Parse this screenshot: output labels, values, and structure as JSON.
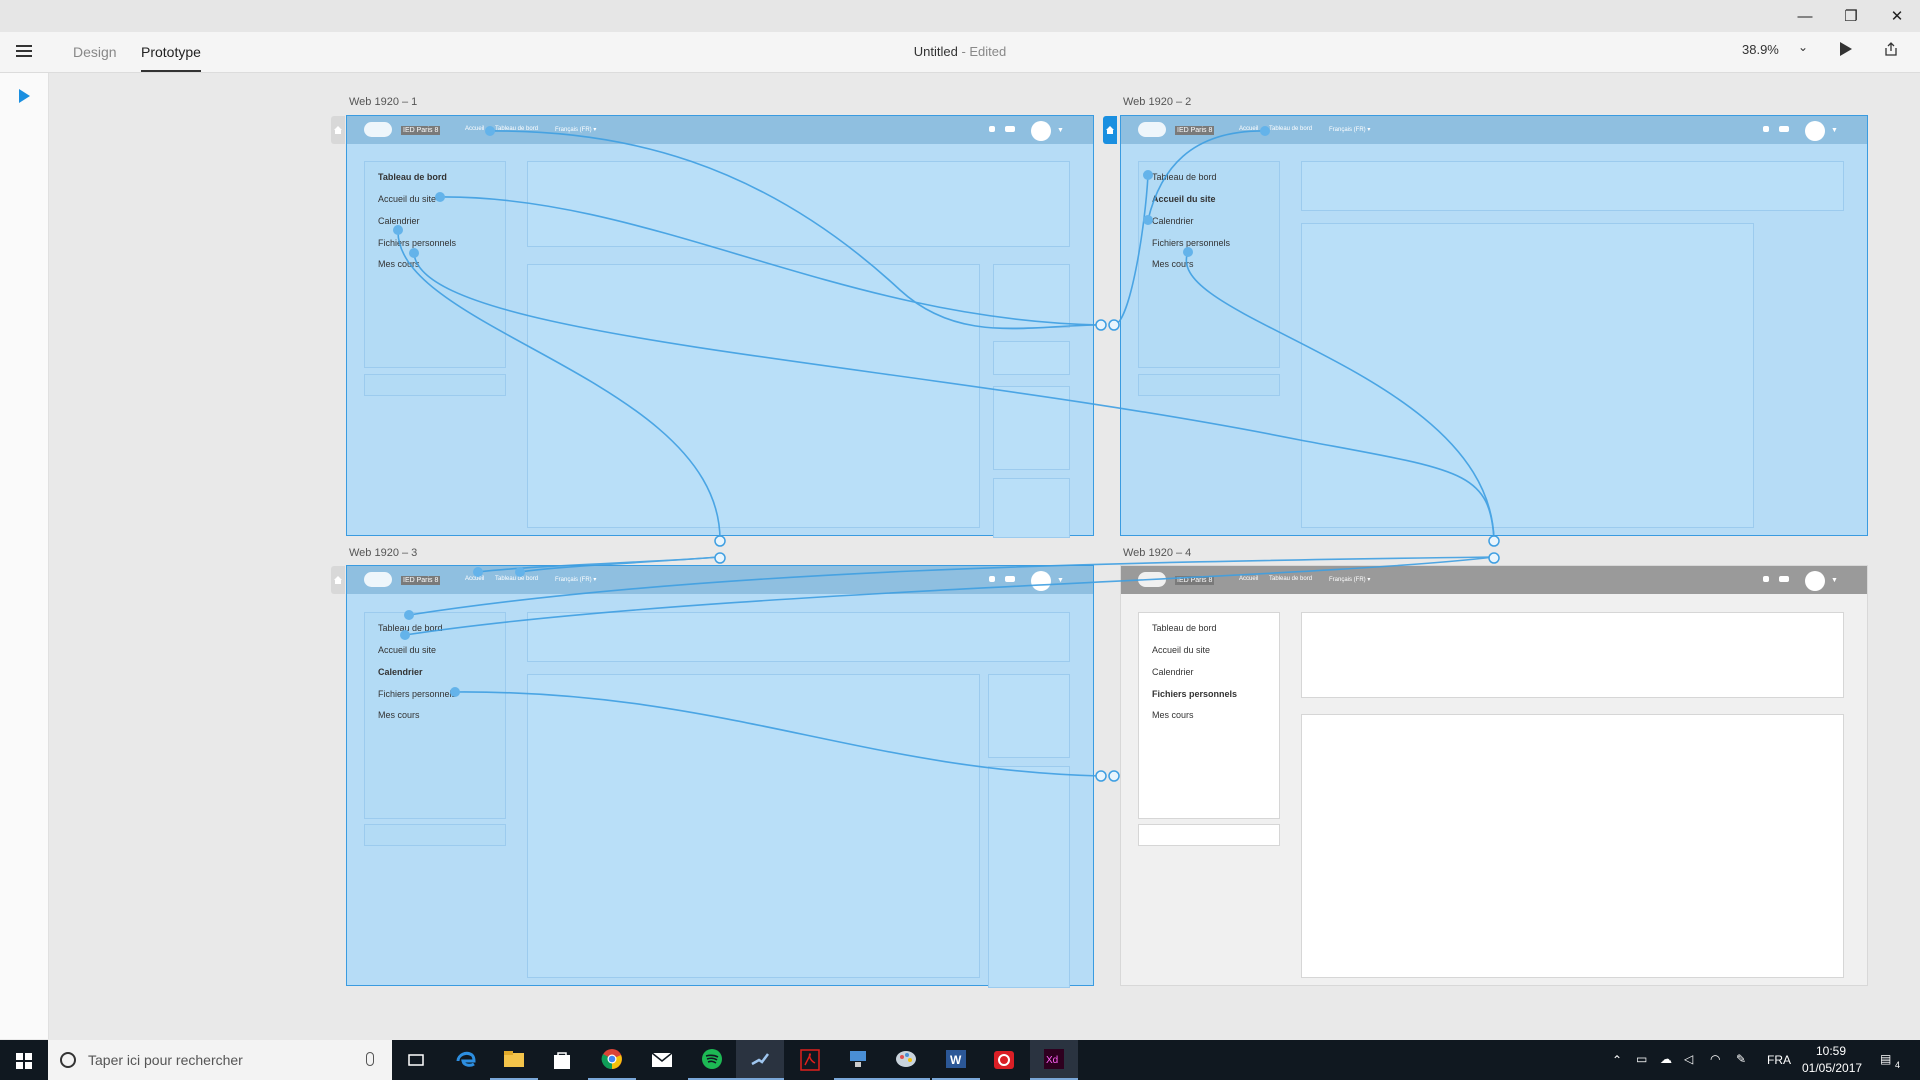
{
  "window": {
    "minimize_glyph": "—",
    "maximize_glyph": "❐",
    "close_glyph": "✕"
  },
  "toolbar": {
    "menu_icon": "hamburger-icon",
    "tabs": [
      {
        "label": "Design",
        "active": false
      },
      {
        "label": "Prototype",
        "active": true
      }
    ],
    "doc_title": "Untitled",
    "doc_status": " - Edited",
    "zoom": "38.9%",
    "zoom_caret": "⌄",
    "play_icon": "play-icon",
    "share_icon": "share-icon"
  },
  "tools": {
    "select_icon": "pointer-icon"
  },
  "artboards": [
    {
      "label": "Web 1920 – 1",
      "header": {
        "logo": "IED Paris 8",
        "nav": [
          "Accueil",
          "Tableau de bord",
          "Français (FR) ▾"
        ]
      },
      "menu": [
        "Tableau de bord",
        "Accueil du site",
        "Calendrier",
        "Fichiers personnels",
        "Mes cours"
      ],
      "active_item": 0
    },
    {
      "label": "Web 1920 – 2",
      "header": {
        "logo": "IED Paris 8",
        "nav": [
          "Accueil",
          "Tableau de bord",
          "Français (FR) ▾"
        ]
      },
      "menu": [
        "Tableau de bord",
        "Accueil du site",
        "Calendrier",
        "Fichiers personnels",
        "Mes cours"
      ],
      "active_item": 1
    },
    {
      "label": "Web 1920 – 3",
      "header": {
        "logo": "IED Paris 8",
        "nav": [
          "Accueil",
          "Tableau de bord",
          "Français (FR) ▾"
        ]
      },
      "menu": [
        "Tableau de bord",
        "Accueil du site",
        "Calendrier",
        "Fichiers personnels",
        "Mes cours"
      ],
      "active_item": 2
    },
    {
      "label": "Web 1920 – 4",
      "header": {
        "logo": "IED Paris 8",
        "nav": [
          "Accueil",
          "Tableau de bord",
          "Français (FR) ▾"
        ]
      },
      "menu": [
        "Tableau de bord",
        "Accueil du site",
        "Calendrier",
        "Fichiers personnels",
        "Mes cours"
      ],
      "active_item": 3
    }
  ],
  "taskbar": {
    "search_placeholder": "Taper ici pour rechercher",
    "apps": [
      "task-view-icon",
      "edge-icon",
      "file-explorer-icon",
      "store-icon",
      "chrome-icon",
      "mail-icon",
      "spotify-icon",
      "steam-icon",
      "acrobat-icon",
      "network-app-icon",
      "paint-icon",
      "word-icon",
      "creative-cloud-icon",
      "adobe-xd-icon"
    ],
    "language": "FRA",
    "time": "10:59",
    "date": "01/05/2017",
    "notifications": "4"
  }
}
